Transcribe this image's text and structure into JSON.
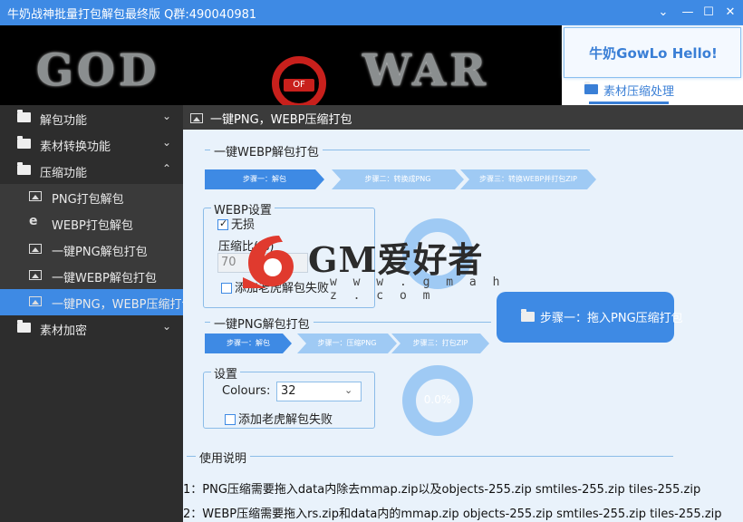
{
  "window": {
    "title": "牛奶战神批量打包解包最终版 Q群:490040981",
    "controls": [
      "⌄",
      "—",
      "☐",
      "✕"
    ]
  },
  "banner": {
    "left_word": "GOD",
    "of": "OF",
    "right_word": "WAR"
  },
  "header": {
    "hello": "牛奶GowLo Hello!",
    "tab_label": "素材压缩处理"
  },
  "sidebar": {
    "items": [
      {
        "label": "解包功能",
        "icon": "folder-icon",
        "chevron": "⌄"
      },
      {
        "label": "素材转换功能",
        "icon": "folder-icon",
        "chevron": "⌄"
      },
      {
        "label": "压缩功能",
        "icon": "folder-icon",
        "chevron": "⌃"
      },
      {
        "label": "PNG打包解包",
        "icon": "image-icon"
      },
      {
        "label": "WEBP打包解包",
        "icon": "edge-icon"
      },
      {
        "label": "一键PNG解包打包",
        "icon": "image-icon"
      },
      {
        "label": "一键WEBP解包打包",
        "icon": "image-icon"
      },
      {
        "label": "一键PNG，WEBP压缩打包",
        "icon": "image-icon"
      },
      {
        "label": "素材加密",
        "icon": "folder-icon",
        "chevron": "⌄"
      }
    ]
  },
  "content": {
    "title": "一键PNG，WEBP压缩打包",
    "webp_section": {
      "title": "一键WEBP解包打包",
      "steps": [
        "步骤一：解包",
        "步骤二：转换成PNG",
        "步骤三：转换WEBP并打包ZIP"
      ],
      "settings_title": "WEBP设置",
      "lossless_label": "无损",
      "ratio_label": "压缩比(%)",
      "ratio_value": "70",
      "tiger_label": "添加老虎解包失败",
      "progress": "0.0%"
    },
    "drop_button": "步骤一：拖入PNG压缩打包",
    "png_section": {
      "title": "一键PNG解包打包",
      "steps": [
        "步骤一：解包",
        "步骤一：压缩PNG",
        "步骤三：打包ZIP"
      ],
      "settings_title": "设置",
      "colours_label": "Colours:",
      "colours_value": "32",
      "tiger_label": "添加老虎解包失败",
      "progress": "0.0%"
    },
    "usage": {
      "title": "使用说明",
      "lines": [
        "1：PNG压缩需要拖入data内除去mmap.zip以及objects-255.zip smtiles-255.zip tiles-255.zip",
        "2：WEBP压缩需要拖入rs.zip和data内的mmap.zip objects-255.zip smtiles-255.zip tiles-255.zip"
      ]
    }
  },
  "watermark": {
    "text": "GM爱好者",
    "url": "w w w . g m a h z . c o m"
  },
  "colors": {
    "accent": "#3e8ae4",
    "sidebar_bg": "#2d2d2d",
    "content_bg": "#e9f2fb",
    "ring": "#9fcaf4"
  }
}
